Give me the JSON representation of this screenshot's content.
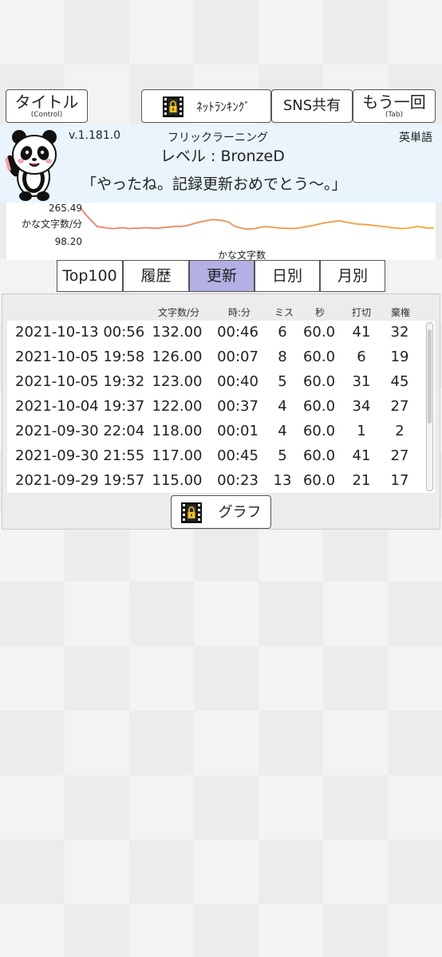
{
  "toolbar": {
    "title_button": {
      "label": "タイトル",
      "sub": "(Control)"
    },
    "ranking_button": {
      "label": "ﾈｯﾄﾗﾝｷﾝｸﾞ"
    },
    "sns_button": {
      "label": "SNS共有"
    },
    "retry_button": {
      "label": "もう一回",
      "sub": "(Tab)"
    }
  },
  "header": {
    "version": "v.1.181.0",
    "game_title": "フリックラーニング",
    "mode": "英単語",
    "level": "レベル : BronzeD",
    "message": "「やったね。記録更新おめでとう～。」"
  },
  "chart_data": {
    "type": "line",
    "ylabel": "かな文字数/分",
    "xlabel": "かな文字数",
    "y_ticks": [
      "265.49",
      "98.20"
    ],
    "ylim": [
      98.2,
      265.49
    ],
    "colors": {
      "start": "#f07b6a",
      "end": "#f0a832"
    },
    "values": [
      265,
      235,
      210,
      185,
      182,
      178,
      176,
      178,
      180,
      176,
      178,
      177,
      180,
      179,
      177,
      179,
      182,
      183,
      187,
      186,
      189,
      196,
      203,
      208,
      213,
      217,
      215,
      212,
      206,
      188,
      181,
      175,
      174,
      176,
      182,
      185,
      183,
      180,
      178,
      177,
      176,
      178,
      181,
      186,
      190,
      196,
      201,
      205,
      208,
      212,
      207,
      202,
      198,
      196,
      194,
      192,
      189,
      186,
      184,
      180,
      178,
      176,
      178,
      182,
      186,
      181,
      178,
      180
    ]
  },
  "tabs": [
    {
      "label": "Top100",
      "active": false
    },
    {
      "label": "履歴",
      "active": false
    },
    {
      "label": "更新",
      "active": true
    },
    {
      "label": "日別",
      "active": false
    },
    {
      "label": "月別",
      "active": false
    }
  ],
  "table": {
    "headers": [
      "文字数/分",
      "時:分",
      "ミス",
      "秒",
      "打切",
      "棄権"
    ],
    "rows": [
      {
        "date": "2021-10-13 00:56",
        "cpm": "132.00",
        "time": "00:46",
        "miss": "6",
        "sec": "60.0",
        "cut": "41",
        "abandon": "32"
      },
      {
        "date": "2021-10-05 19:58",
        "cpm": "126.00",
        "time": "00:07",
        "miss": "8",
        "sec": "60.0",
        "cut": "6",
        "abandon": "19"
      },
      {
        "date": "2021-10-05 19:32",
        "cpm": "123.00",
        "time": "00:40",
        "miss": "5",
        "sec": "60.0",
        "cut": "31",
        "abandon": "45"
      },
      {
        "date": "2021-10-04 19:37",
        "cpm": "122.00",
        "time": "00:37",
        "miss": "4",
        "sec": "60.0",
        "cut": "34",
        "abandon": "27"
      },
      {
        "date": "2021-09-30 22:04",
        "cpm": "118.00",
        "time": "00:01",
        "miss": "4",
        "sec": "60.0",
        "cut": "1",
        "abandon": "2"
      },
      {
        "date": "2021-09-30 21:55",
        "cpm": "117.00",
        "time": "00:45",
        "miss": "5",
        "sec": "60.0",
        "cut": "41",
        "abandon": "27"
      },
      {
        "date": "2021-09-29 19:57",
        "cpm": "115.00",
        "time": "00:23",
        "miss": "13",
        "sec": "60.0",
        "cut": "21",
        "abandon": "17"
      }
    ]
  },
  "graph_button": {
    "label": "グラフ"
  }
}
